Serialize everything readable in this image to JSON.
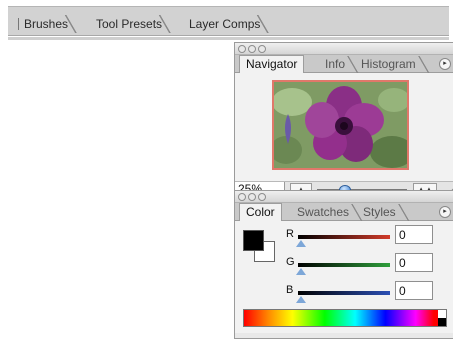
{
  "well": {
    "tabs": [
      {
        "label": "Brushes"
      },
      {
        "label": "Tool Presets"
      },
      {
        "label": "Layer Comps"
      }
    ]
  },
  "navigator_palette": {
    "tabs": [
      {
        "label": "Navigator",
        "active": true
      },
      {
        "label": "Info",
        "active": false
      },
      {
        "label": "Histogram",
        "active": false
      }
    ],
    "zoom": "25%",
    "zoom_slider_fraction": 0.3,
    "thumbnail_icon": "petunia-flower-thumbnail"
  },
  "color_palette": {
    "tabs": [
      {
        "label": "Color",
        "active": true
      },
      {
        "label": "Swatches",
        "active": false
      },
      {
        "label": "Styles",
        "active": false
      }
    ],
    "foreground_color": "#000000",
    "background_color": "#ffffff",
    "channels": [
      {
        "label": "R",
        "value": "0",
        "color": "#d23b2a"
      },
      {
        "label": "G",
        "value": "0",
        "color": "#2e9f3b"
      },
      {
        "label": "B",
        "value": "0",
        "color": "#2b4fb5"
      }
    ]
  },
  "colors": {
    "navigator_thumbnail_border": "#e0786a",
    "zoom_slider_thumb": "#3b7fd1"
  }
}
